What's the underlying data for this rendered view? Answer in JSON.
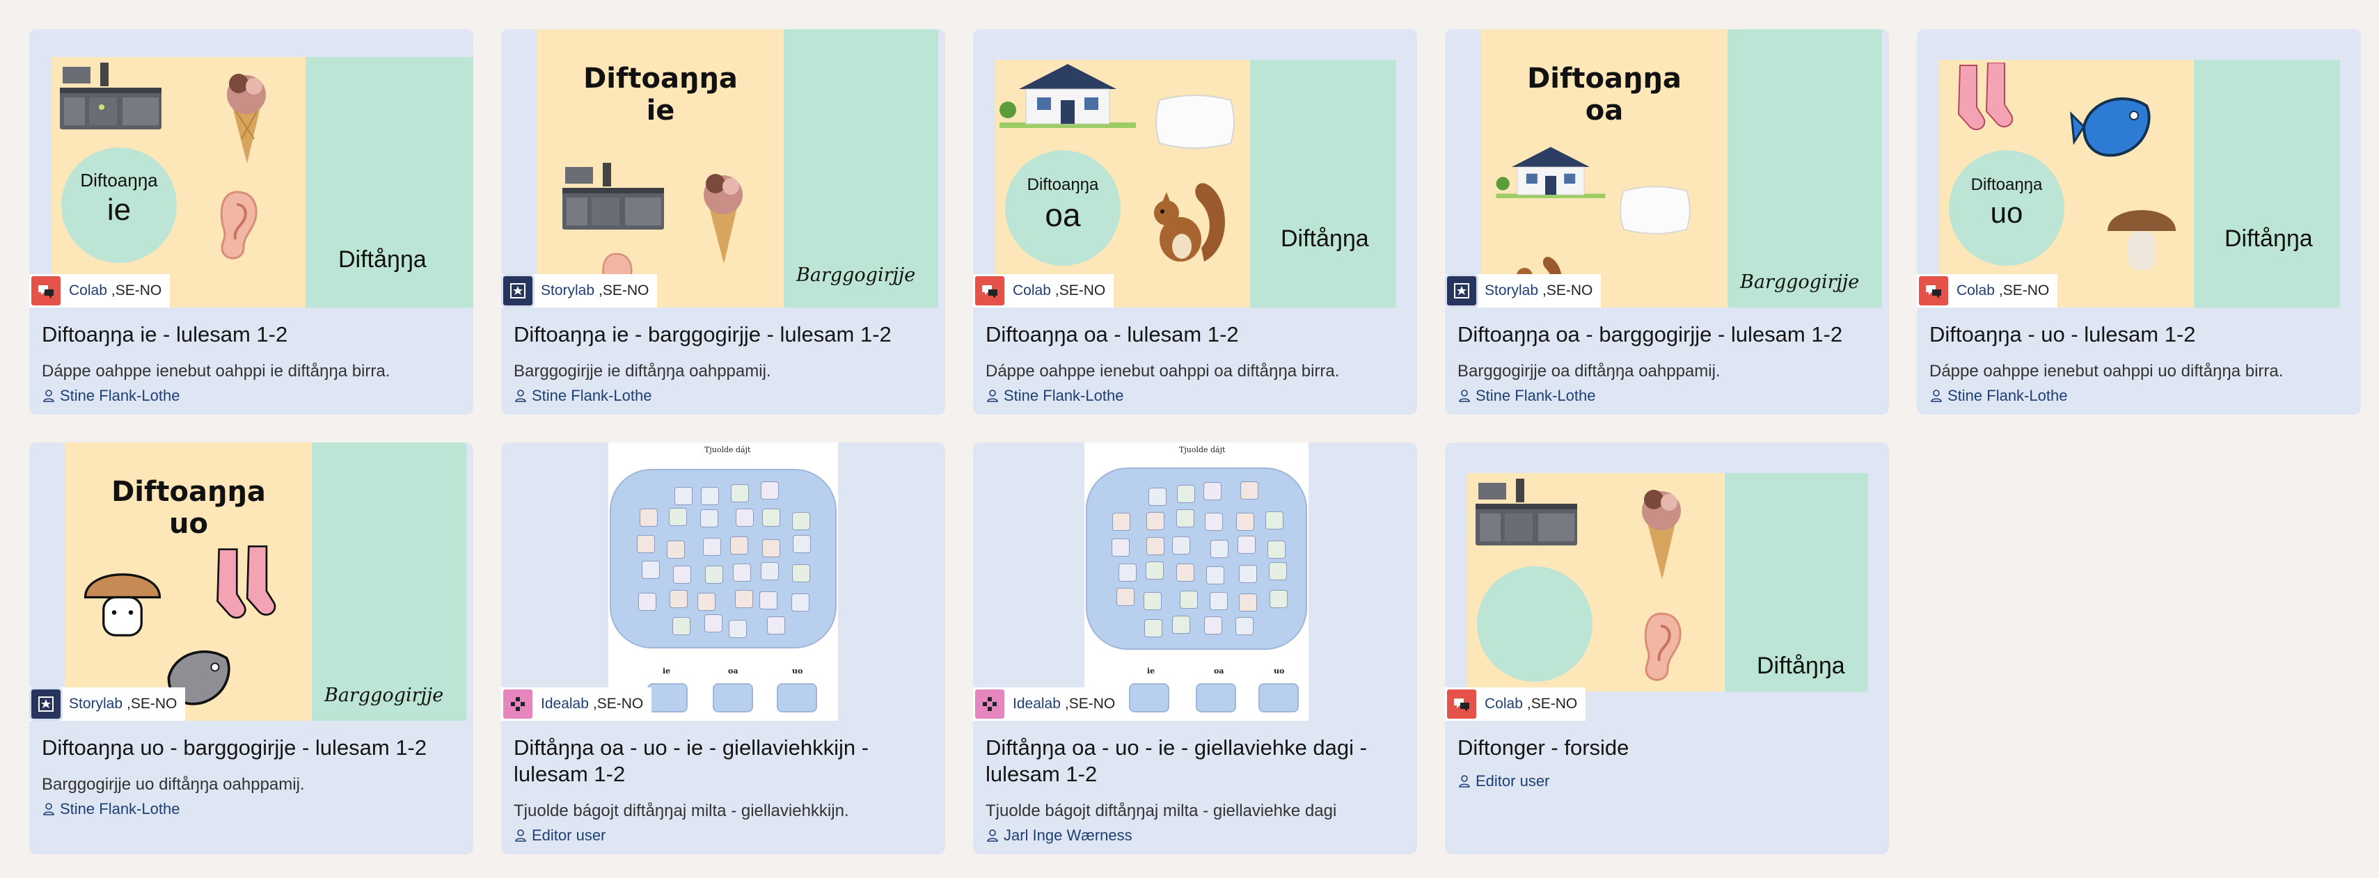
{
  "cards": [
    {
      "lab": "Colab",
      "region": ",SE-NO",
      "title": "Diftoaŋŋa ie - lulesam 1-2",
      "description": "Dáppe oahppe ienebut oahppi ie diftåŋŋa birra.",
      "author": "Stine Flank-Lothe",
      "thumb": {
        "circle_word": "Diftoaŋŋa",
        "circle_letters": "ie",
        "green_label": "Diftåŋŋa"
      }
    },
    {
      "lab": "Storylab",
      "region": ",SE-NO",
      "title": "Diftoaŋŋa ie - barggogirjje - lulesam 1-2",
      "description": "Barggogirjje ie diftåŋŋa oahppamij.",
      "author": "Stine Flank-Lothe",
      "thumb": {
        "big_title": "Diftoaŋŋa",
        "big_sub": "ie",
        "green_label": "Barggogirjje"
      }
    },
    {
      "lab": "Colab",
      "region": ",SE-NO",
      "title": "Diftoaŋŋa oa - lulesam 1-2",
      "description": "Dáppe oahppe ienebut oahppi oa diftåŋŋa birra.",
      "author": "Stine Flank-Lothe",
      "thumb": {
        "circle_word": "Diftoaŋŋa",
        "circle_letters": "oa",
        "green_label": "Diftåŋŋa"
      }
    },
    {
      "lab": "Storylab",
      "region": ",SE-NO",
      "title": "Diftoaŋŋa oa - barggogirjje - lulesam 1-2",
      "description": "Barggogirjje oa diftåŋŋa oahppamij.",
      "author": "Stine Flank-Lothe",
      "thumb": {
        "big_title": "Diftoaŋŋa",
        "big_sub": "oa",
        "green_label": "Barggogirjje"
      }
    },
    {
      "lab": "Colab",
      "region": ",SE-NO",
      "title": "Diftoaŋŋa - uo - lulesam 1-2",
      "description": "Dáppe oahppe ienebut oahppi uo diftåŋŋa birra.",
      "author": "Stine Flank-Lothe",
      "thumb": {
        "circle_word": "Diftoaŋŋa",
        "circle_letters": "uo",
        "green_label": "Diftåŋŋa"
      }
    },
    {
      "lab": "Storylab",
      "region": ",SE-NO",
      "title": "Diftoaŋŋa uo - barggogirjje - lulesam 1-2",
      "description": "Barggogirjje uo diftåŋŋa oahppamij.",
      "author": "Stine Flank-Lothe",
      "thumb": {
        "big_title": "Diftoaŋŋa",
        "big_sub": "uo",
        "green_label": "Barggogirjje"
      }
    },
    {
      "lab": "Idealab",
      "region": ",SE-NO",
      "title": "Diftåŋŋa oa - uo - ie - giellaviehkkijn - lulesam 1-2",
      "description": "Tjuolde bágojt diftåŋŋaj milta - giellaviehkkijn.",
      "author": "Editor user",
      "thumb": {
        "sheet_title": "Tjuolde dájt",
        "cols": [
          "ie",
          "oa",
          "uo"
        ]
      }
    },
    {
      "lab": "Idealab",
      "region": ",SE-NO",
      "title": "Diftåŋŋa oa - uo - ie - giellaviehke dagi - lulesam 1-2",
      "description": "Tjuolde bágojt diftåŋŋaj milta - giellaviehke dagi",
      "author": "Jarl Inge Wærness",
      "thumb": {
        "sheet_title": "Tjuolde dájt",
        "cols": [
          "ie",
          "oa",
          "uo"
        ]
      }
    },
    {
      "lab": "Colab",
      "region": ",SE-NO",
      "title": "Diftonger - forside",
      "description": "",
      "author": "Editor user",
      "thumb": {
        "green_label": "Diftåŋŋa"
      }
    }
  ],
  "colors": {
    "page_bg": "#f4f1ee",
    "card_bg": "#dfe6f3",
    "slide_yellow": "#fde7b8",
    "slide_green": "#bde5d5",
    "link_blue": "#1d3f73",
    "colab_red": "#e4524a",
    "storylab_navy": "#27345e",
    "idealab_pink": "#e686bf"
  }
}
